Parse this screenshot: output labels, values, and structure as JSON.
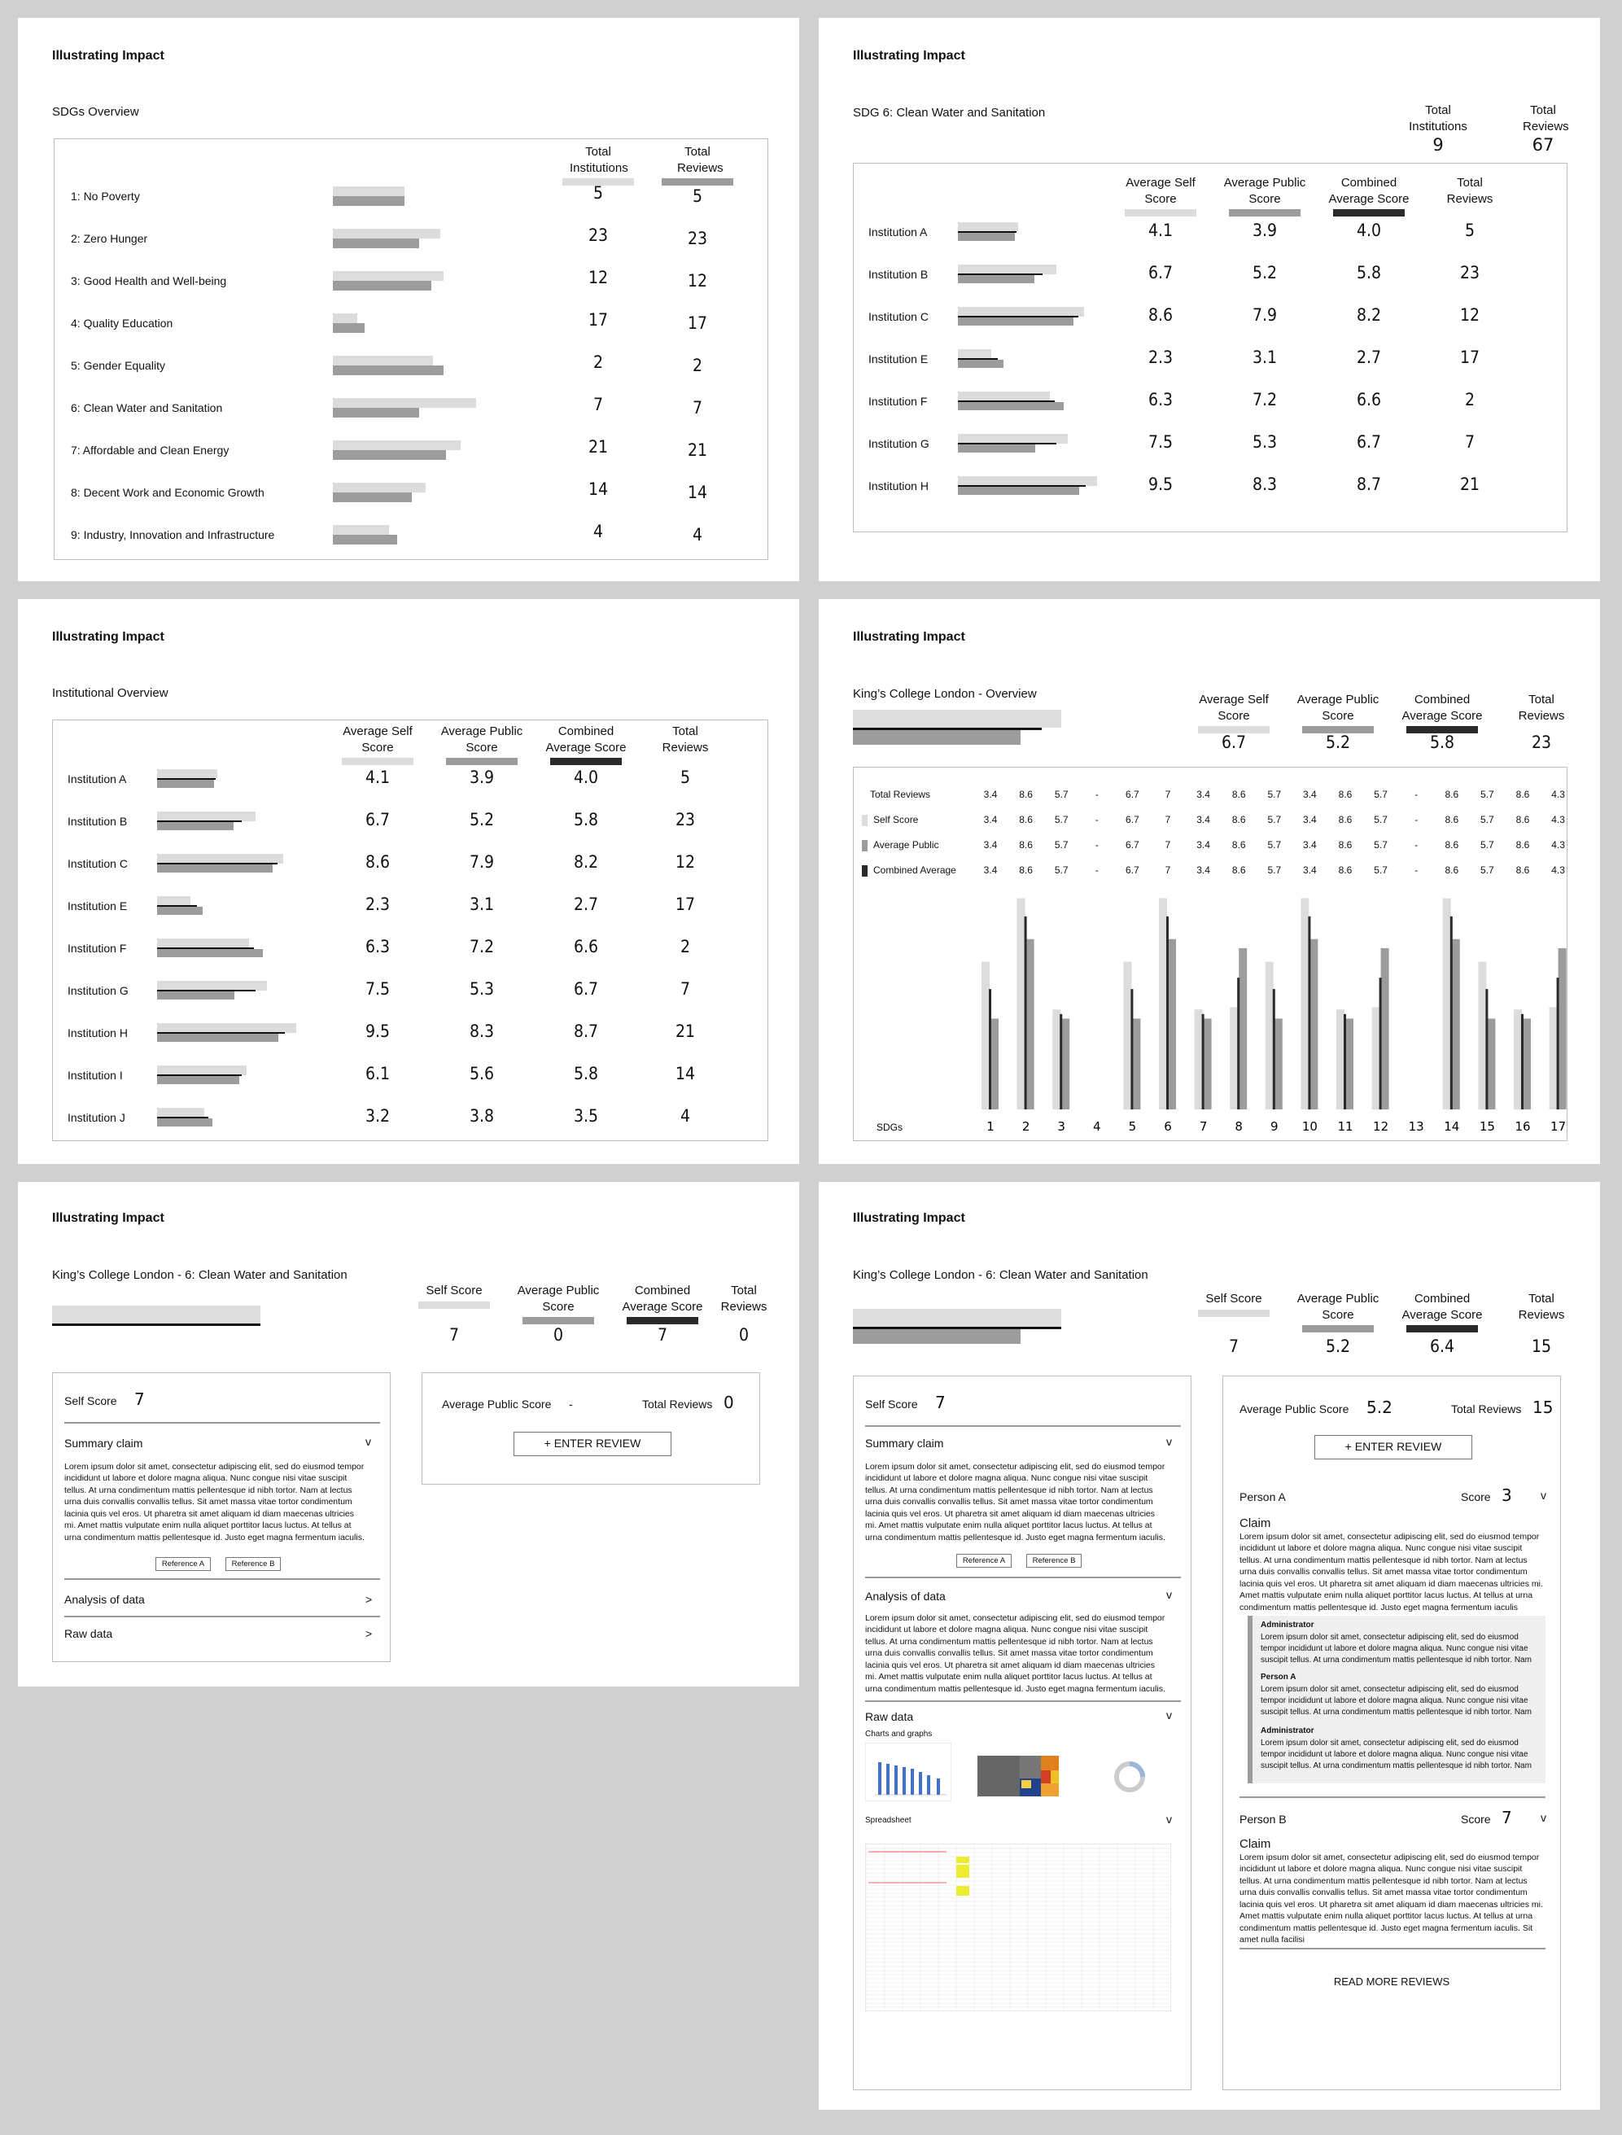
{
  "brand": "Illustrating Impact",
  "panel1": {
    "subtitle": "SDGs Overview",
    "col_institutions": "Total Institutions",
    "col_reviews": "Total Reviews",
    "rows": [
      {
        "label": "1: No Poverty",
        "institutions": "5",
        "reviews": "5",
        "a": 0.5,
        "b": 0.5
      },
      {
        "label": "2: Zero Hunger",
        "institutions": "23",
        "reviews": "23",
        "a": 0.75,
        "b": 0.6
      },
      {
        "label": "3: Good Health and Well-being",
        "institutions": "12",
        "reviews": "12",
        "a": 0.77,
        "b": 0.69
      },
      {
        "label": "4: Quality Education",
        "institutions": "17",
        "reviews": "17",
        "a": 0.17,
        "b": 0.22
      },
      {
        "label": "5: Gender Equality",
        "institutions": "2",
        "reviews": "2",
        "a": 0.7,
        "b": 0.77
      },
      {
        "label": "6: Clean Water and Sanitation",
        "institutions": "7",
        "reviews": "7",
        "a": 1.0,
        "b": 0.6
      },
      {
        "label": "7: Affordable and Clean Energy",
        "institutions": "21",
        "reviews": "21",
        "a": 0.89,
        "b": 0.79
      },
      {
        "label": "8: Decent Work and Economic Growth",
        "institutions": "14",
        "reviews": "14",
        "a": 0.65,
        "b": 0.55
      },
      {
        "label": "9: Industry, Innovation and Infrastructure",
        "institutions": "4",
        "reviews": "4",
        "a": 0.39,
        "b": 0.45
      }
    ]
  },
  "panel2": {
    "subtitle": "SDG 6: Clean Water and Sanitation",
    "top_institutions_label": "Total Institutions",
    "top_institutions": "9",
    "top_reviews_label": "Total Reviews",
    "top_reviews": "67",
    "cols": [
      "Average Self Score",
      "Average Public Score",
      "Combined Average Score",
      "Total Reviews"
    ],
    "rows": [
      {
        "label": "Institution A",
        "self": "4.1",
        "public": "3.9",
        "combined": "4.0",
        "reviews": "5"
      },
      {
        "label": "Institution B",
        "self": "6.7",
        "public": "5.2",
        "combined": "5.8",
        "reviews": "23"
      },
      {
        "label": "Institution C",
        "self": "8.6",
        "public": "7.9",
        "combined": "8.2",
        "reviews": "12"
      },
      {
        "label": "Institution E",
        "self": "2.3",
        "public": "3.1",
        "combined": "2.7",
        "reviews": "17"
      },
      {
        "label": "Institution F",
        "self": "6.3",
        "public": "7.2",
        "combined": "6.6",
        "reviews": "2"
      },
      {
        "label": "Institution G",
        "self": "7.5",
        "public": "5.3",
        "combined": "6.7",
        "reviews": "7"
      },
      {
        "label": "Institution H",
        "self": "9.5",
        "public": "8.3",
        "combined": "8.7",
        "reviews": "21"
      }
    ]
  },
  "panel3": {
    "subtitle": "Institutional Overview",
    "cols": [
      "Average Self Score",
      "Average Public Score",
      "Combined Average Score",
      "Total Reviews"
    ],
    "rows": [
      {
        "label": "Institution A",
        "self": "4.1",
        "public": "3.9",
        "combined": "4.0",
        "reviews": "5"
      },
      {
        "label": "Institution B",
        "self": "6.7",
        "public": "5.2",
        "combined": "5.8",
        "reviews": "23"
      },
      {
        "label": "Institution C",
        "self": "8.6",
        "public": "7.9",
        "combined": "8.2",
        "reviews": "12"
      },
      {
        "label": "Institution E",
        "self": "2.3",
        "public": "3.1",
        "combined": "2.7",
        "reviews": "17"
      },
      {
        "label": "Institution F",
        "self": "6.3",
        "public": "7.2",
        "combined": "6.6",
        "reviews": "2"
      },
      {
        "label": "Institution G",
        "self": "7.5",
        "public": "5.3",
        "combined": "6.7",
        "reviews": "7"
      },
      {
        "label": "Institution H",
        "self": "9.5",
        "public": "8.3",
        "combined": "8.7",
        "reviews": "21"
      },
      {
        "label": "Institution I",
        "self": "6.1",
        "public": "5.6",
        "combined": "5.8",
        "reviews": "14"
      },
      {
        "label": "Institution J",
        "self": "3.2",
        "public": "3.8",
        "combined": "3.5",
        "reviews": "4"
      }
    ]
  },
  "panel4": {
    "subtitle": "King’s College London - Overview",
    "cols": [
      "Average Self Score",
      "Average Public Score",
      "Combined Average Score",
      "Total Reviews"
    ],
    "values": [
      "6.7",
      "5.2",
      "5.8",
      "23"
    ],
    "table_rows": [
      {
        "label": "Total Reviews",
        "values": [
          "3.4",
          "8.6",
          "5.7",
          "-",
          "6.7",
          "7",
          "3.4",
          "8.6",
          "5.7",
          "3.4",
          "8.6",
          "5.7",
          "-",
          "8.6",
          "5.7",
          "8.6",
          "4.3"
        ]
      },
      {
        "label": "Self Score",
        "values": [
          "3.4",
          "8.6",
          "5.7",
          "-",
          "6.7",
          "7",
          "3.4",
          "8.6",
          "5.7",
          "3.4",
          "8.6",
          "5.7",
          "-",
          "8.6",
          "5.7",
          "8.6",
          "4.3"
        ]
      },
      {
        "label": "Average Public",
        "values": [
          "3.4",
          "8.6",
          "5.7",
          "-",
          "6.7",
          "7",
          "3.4",
          "8.6",
          "5.7",
          "3.4",
          "8.6",
          "5.7",
          "-",
          "8.6",
          "5.7",
          "8.6",
          "4.3"
        ]
      },
      {
        "label": "Combined Average",
        "values": [
          "3.4",
          "8.6",
          "5.7",
          "-",
          "6.7",
          "7",
          "3.4",
          "8.6",
          "5.7",
          "3.4",
          "8.6",
          "5.7",
          "-",
          "8.6",
          "5.7",
          "8.6",
          "4.3"
        ]
      }
    ],
    "x_title": "SDGs",
    "colors": {
      "self": "#dcdcdc",
      "public": "#9c9c9c",
      "combined": "#2a2a2a"
    }
  },
  "chart_data": {
    "type": "bar",
    "categories": [
      "1",
      "2",
      "3",
      "4",
      "5",
      "6",
      "7",
      "8",
      "9",
      "10",
      "11",
      "12",
      "13",
      "14",
      "15",
      "16",
      "17"
    ],
    "series": [
      {
        "name": "Self Score",
        "values": [
          6.5,
          9.3,
          4.4,
          0,
          6.5,
          9.3,
          4.4,
          4.5,
          6.5,
          9.3,
          4.4,
          4.5,
          0,
          9.3,
          6.5,
          4.4,
          4.5
        ]
      },
      {
        "name": "Average Public",
        "values": [
          4.0,
          7.5,
          4.0,
          0,
          4.0,
          7.5,
          4.0,
          7.1,
          4.0,
          7.5,
          4.0,
          7.1,
          0,
          7.5,
          4.0,
          4.0,
          7.1
        ]
      },
      {
        "name": "Combined Average",
        "values": [
          5.3,
          8.5,
          4.2,
          0,
          5.3,
          8.5,
          4.2,
          5.8,
          5.3,
          8.5,
          4.2,
          5.8,
          0,
          8.5,
          5.3,
          4.2,
          5.8
        ]
      }
    ],
    "xlabel": "SDGs",
    "ylim": [
      0,
      10
    ]
  },
  "panel5": {
    "subtitle": "King’s College London - 6: Clean Water and Sanitation",
    "cols": [
      "Self Score",
      "Average Public Score",
      "Combined Average Score",
      "Total Reviews"
    ],
    "values": [
      "7",
      "0",
      "7",
      "0"
    ],
    "self_score_label": "Self Score",
    "self_score": "7",
    "summary_claim": "Summary claim",
    "lorem": "Lorem ipsum dolor sit amet, consectetur adipiscing elit, sed do eiusmod tempor incididunt ut labore et dolore magna aliqua. Nunc congue nisi vitae suscipit tellus. At urna condimentum mattis pellentesque id nibh tortor. Nam at lectus urna duis convallis convallis tellus. Sit amet massa vitae tortor condimentum lacinia quis vel eros. Ut pharetra sit amet aliquam id diam maecenas ultricies mi. Amet mattis vulputate enim nulla aliquet porttitor lacus luctus. At tellus at urna condimentum mattis pellentesque id. Justo eget magna fermentum iaculis.",
    "ref_a": "Reference A",
    "ref_b": "Reference B",
    "analysis": "Analysis of data",
    "raw": "Raw data",
    "avg_public_label": "Average Public Score",
    "avg_public": "-",
    "total_reviews_label": "Total Reviews",
    "total_reviews": "0",
    "enter_review": "+ ENTER REVIEW",
    "chev_down": "v",
    "chev_right": ">"
  },
  "panel6": {
    "subtitle": "King’s College London - 6: Clean Water and Sanitation",
    "cols": [
      "Self Score",
      "Average Public Score",
      "Combined Average Score",
      "Total Reviews"
    ],
    "values": [
      "7",
      "5.2",
      "6.4",
      "15"
    ],
    "self_score_label": "Self Score",
    "self_score": "7",
    "summary_claim": "Summary claim",
    "lorem": "Lorem ipsum dolor sit amet, consectetur adipiscing elit, sed do eiusmod tempor incididunt ut labore et dolore magna aliqua. Nunc congue nisi vitae suscipit tellus. At urna condimentum mattis pellentesque id nibh tortor. Nam at lectus urna duis convallis convallis tellus. Sit amet massa vitae tortor condimentum lacinia quis vel eros. Ut pharetra sit amet aliquam id diam maecenas ultricies mi. Amet mattis vulputate enim nulla aliquet porttitor lacus luctus. At tellus at urna condimentum mattis pellentesque id. Justo eget magna fermentum iaculis.",
    "ref_a": "Reference A",
    "ref_b": "Reference B",
    "analysis": "Analysis of data",
    "raw": "Raw data",
    "charts_graphs": "Charts and graphs",
    "spreadsheet": "Spreadsheet",
    "avg_public_label": "Average Public Score",
    "avg_public": "5.2",
    "total_reviews_label": "Total Reviews",
    "total_reviews": "15",
    "enter_review": "+ ENTER REVIEW",
    "person_a": "Person A",
    "person_a_score_label": "Score",
    "person_a_score": "3",
    "claim": "Claim",
    "review_text": "Lorem ipsum dolor sit amet, consectetur adipiscing elit, sed do eiusmod tempor incididunt ut labore et dolore magna aliqua. Nunc congue nisi vitae suscipit tellus. At urna condimentum mattis pellentesque id nibh tortor. Nam at lectus urna duis convallis convallis tellus. Sit amet massa vitae tortor condimentum lacinia quis vel eros. Ut pharetra sit amet aliquam id diam maecenas ultricies mi. Amet mattis vulputate enim nulla aliquet porttitor lacus luctus. At tellus at urna condimentum mattis pellentesque id. Justo eget magna fermentum iaculis",
    "admin": "Administrator",
    "reply_text": "Lorem ipsum dolor sit amet, consectetur adipiscing elit, sed do eiusmod tempor incididunt ut labore et dolore magna aliqua. Nunc congue nisi vitae suscipit tellus. At urna condimentum mattis pellentesque id nibh tortor. Nam",
    "person_a_reply": "Person A",
    "person_b": "Person B",
    "person_b_score_label": "Score",
    "person_b_score": "7",
    "review_text_b": "Lorem ipsum dolor sit amet, consectetur adipiscing elit, sed do eiusmod tempor incididunt ut labore et dolore magna aliqua. Nunc congue nisi vitae suscipit tellus. At urna condimentum mattis pellentesque id nibh tortor. Nam at lectus urna duis convallis convallis tellus. Sit amet massa vitae tortor condimentum lacinia quis vel eros. Ut pharetra sit amet aliquam id diam maecenas ultricies mi. Amet mattis vulputate enim nulla aliquet porttitor lacus luctus. At tellus at urna condimentum mattis pellentesque id. Justo eget magna fermentum iaculis. Sit amet nulla facilisi",
    "read_more": "READ MORE REVIEWS",
    "chev_down": "v"
  }
}
